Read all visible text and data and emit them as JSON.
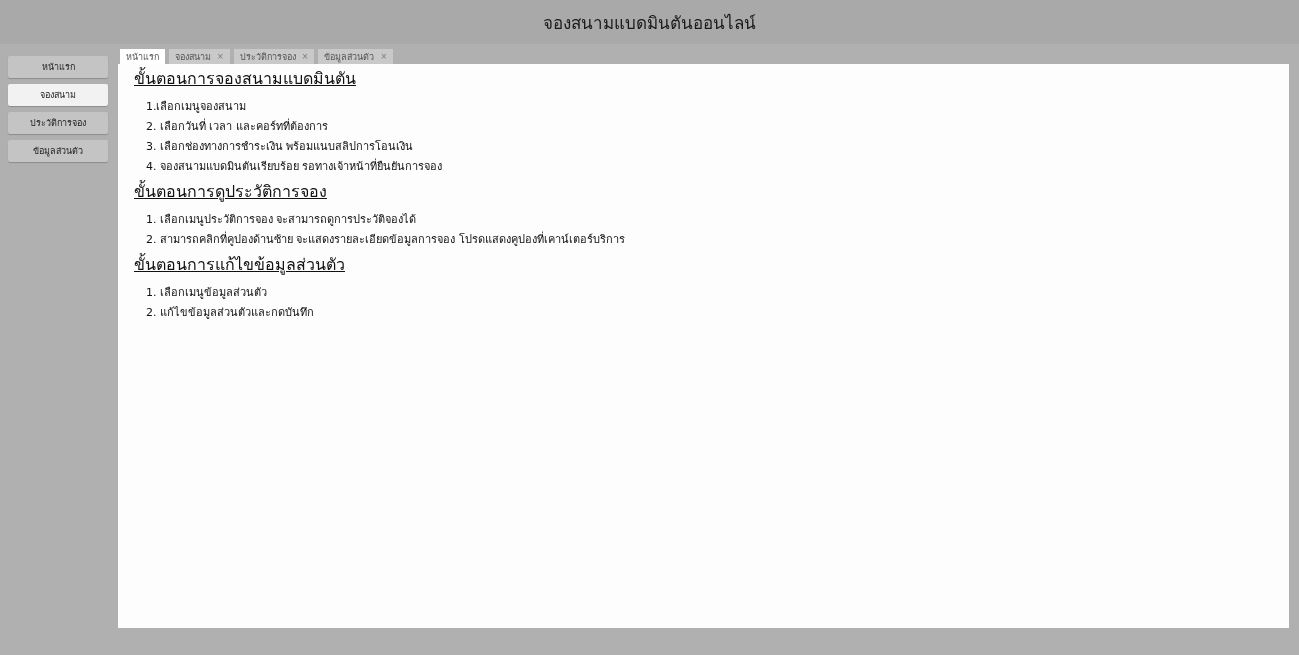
{
  "window": {
    "title": "จองสนามแบดมินตันออนไลน์"
  },
  "sidebar": {
    "items": [
      {
        "label": "หน้าแรก",
        "selected": false
      },
      {
        "label": "จองสนาม",
        "selected": true
      },
      {
        "label": "ประวัติการจอง",
        "selected": false
      },
      {
        "label": "ข้อมูลส่วนตัว",
        "selected": false
      }
    ]
  },
  "tabs": [
    {
      "label": "หน้าแรก",
      "selected": true
    },
    {
      "label": "จองสนาม",
      "selected": false,
      "close": "×"
    },
    {
      "label": "ประวัติการจอง",
      "selected": false,
      "close": "×"
    },
    {
      "label": "ข้อมูลส่วนตัว",
      "selected": false,
      "close": "×"
    }
  ],
  "sections": [
    {
      "heading": "ขั้นตอนการจองสนามแบดมินตัน",
      "steps": [
        "1.เลือกเมนูจองสนาม",
        "2. เลือกวันที่ เวลา และคอร์ทที่ต้องการ",
        "3. เลือกช่องทางการชำระเงิน พร้อมแนบสลิปการโอนเงิน",
        "4. จองสนามแบดมินตันเรียบร้อย รอทางเจ้าหน้าที่ยืนยันการจอง"
      ]
    },
    {
      "heading": "ขั้นตอนการดูประวัติการจอง",
      "steps": [
        "1. เลือกเมนูประวัติการจอง จะสามารถดูการประวัติจองได้",
        "2. สามารถคลิกที่คูปองด้านซ้าย จะแสดงรายละเอียดข้อมูลการจอง โปรดแสดงคูปองที่เคาน์เตอร์บริการ"
      ]
    },
    {
      "heading": "ขั้นตอนการแก้ไขข้อมูลส่วนตัว",
      "steps": [
        "1. เลือกเมนูข้อมูลส่วนตัว",
        "2. แก้ไขข้อมูลส่วนตัวและกดบันทึก"
      ]
    }
  ]
}
